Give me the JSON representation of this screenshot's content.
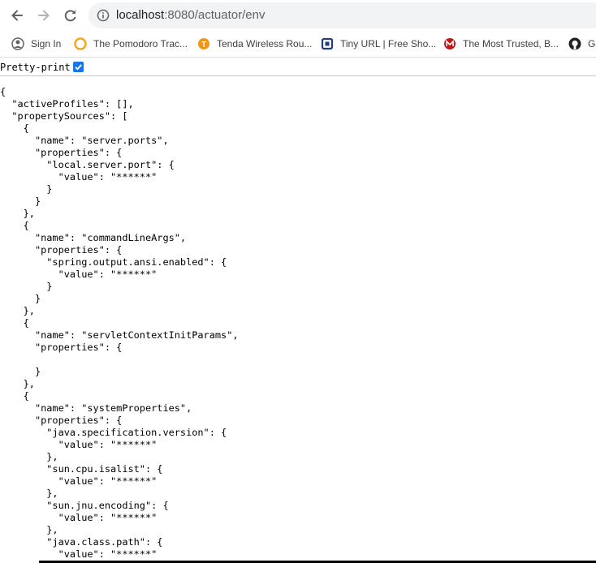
{
  "browser": {
    "url_host": "localhost",
    "url_rest": ":8080/actuator/env",
    "colors": {
      "toolbar_bg": "#ffffff",
      "omnibox_bg": "#f1f3f4",
      "accent": "#1a73e8"
    }
  },
  "bookmarks": [
    {
      "label": "Sign In",
      "icon": "google-icon"
    },
    {
      "label": "The Pomodoro Trac...",
      "icon": "pomodoro-icon"
    },
    {
      "label": "Tenda Wireless Rou...",
      "icon": "tenda-icon"
    },
    {
      "label": "Tiny URL | Free Sho...",
      "icon": "tinyurl-icon"
    },
    {
      "label": "The Most Trusted, B...",
      "icon": "mcafee-icon"
    },
    {
      "label": "Gi",
      "icon": "github-icon"
    }
  ],
  "pretty_print": {
    "label": "Pretty-print",
    "checked": true
  },
  "json_lines": [
    "{",
    "  \"activeProfiles\": [],",
    "  \"propertySources\": [",
    "    {",
    "      \"name\": \"server.ports\",",
    "      \"properties\": {",
    "        \"local.server.port\": {",
    "          \"value\": \"******\"",
    "        }",
    "      }",
    "    },",
    "    {",
    "      \"name\": \"commandLineArgs\",",
    "      \"properties\": {",
    "        \"spring.output.ansi.enabled\": {",
    "          \"value\": \"******\"",
    "        }",
    "      }",
    "    },",
    "    {",
    "      \"name\": \"servletContextInitParams\",",
    "      \"properties\": {",
    "",
    "      }",
    "    },",
    "    {",
    "      \"name\": \"systemProperties\",",
    "      \"properties\": {",
    "        \"java.specification.version\": {",
    "          \"value\": \"******\"",
    "        },",
    "        \"sun.cpu.isalist\": {",
    "          \"value\": \"******\"",
    "        },",
    "        \"sun.jnu.encoding\": {",
    "          \"value\": \"******\"",
    "        },",
    "        \"java.class.path\": {",
    "          \"value\": \"******\""
  ]
}
